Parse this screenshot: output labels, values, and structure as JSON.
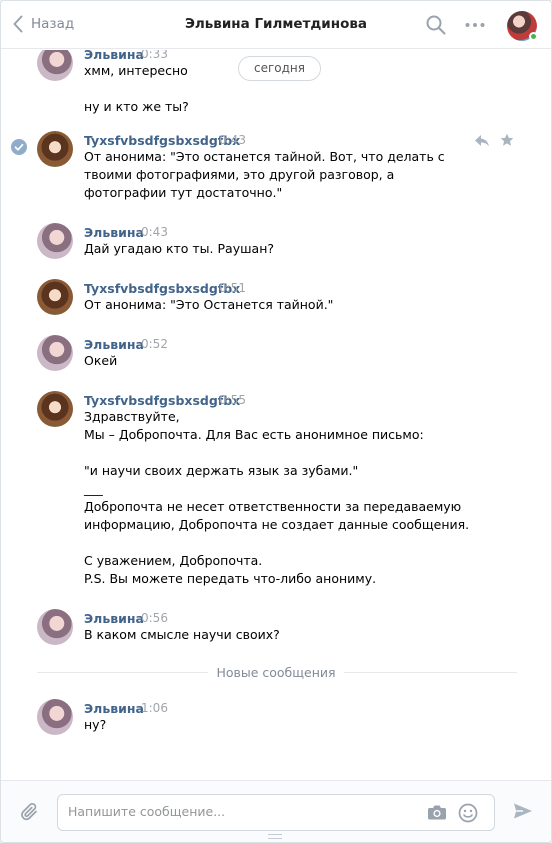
{
  "header": {
    "back_label": "Назад",
    "title": "Эльвина Гилметдинова"
  },
  "date_pill": "сегодня",
  "messages": [
    {
      "author": "Эльвина",
      "time": "0:33",
      "text": "хмм, интересно\n\nну и кто же ты?"
    },
    {
      "author": "Tyxsfvbsdfgsbxsdgfbx",
      "time": "0:43",
      "text": "От анонима: \"Это останется тайной. Вот, что делать с твоими фотографиями, это другой разговор, а фотографии тут достаточно.\""
    },
    {
      "author": "Эльвина",
      "time": "0:43",
      "text": "Дай угадаю кто ты. Раушан?"
    },
    {
      "author": "Tyxsfvbsdfgsbxsdgfbx",
      "time": "0:51",
      "text": "От анонима: \"Это Останется тайной.\""
    },
    {
      "author": "Эльвина",
      "time": "0:52",
      "text": "Окей"
    },
    {
      "author": "Tyxsfvbsdfgsbxsdgfbx",
      "time": "0:55",
      "text": "Здравствуйте,\nМы – Добропочта. Для Вас есть анонимное письмо:\n\n\"и научи своих держать язык за зубами.\"\n___\nДобропочта не несет ответственности за передаваемую информацию, Добропочта не создает данные сообщения.\n\nС уважением, Добропочта.\nP.S. Вы можете передать что-либо анониму."
    },
    {
      "author": "Эльвина",
      "time": "0:56",
      "text": "В каком смысле научи своих?"
    },
    {
      "author": "Эльвина",
      "time": "1:06",
      "text": "ну?"
    }
  ],
  "new_messages_label": "Новые сообщения",
  "composer": {
    "placeholder": "Напишите сообщение...",
    "value": ""
  },
  "icons": {
    "back": "chevron-left-icon",
    "search": "search-icon",
    "more": "more-icon",
    "check": "check-circle-icon",
    "reply": "reply-icon",
    "star": "star-icon",
    "attach": "paperclip-icon",
    "camera": "camera-icon",
    "smile": "smile-icon",
    "send": "send-icon"
  },
  "colors": {
    "author": "#42648b",
    "time": "#a0a5ab",
    "online": "#4bb34b",
    "check": "#8fadc8"
  }
}
